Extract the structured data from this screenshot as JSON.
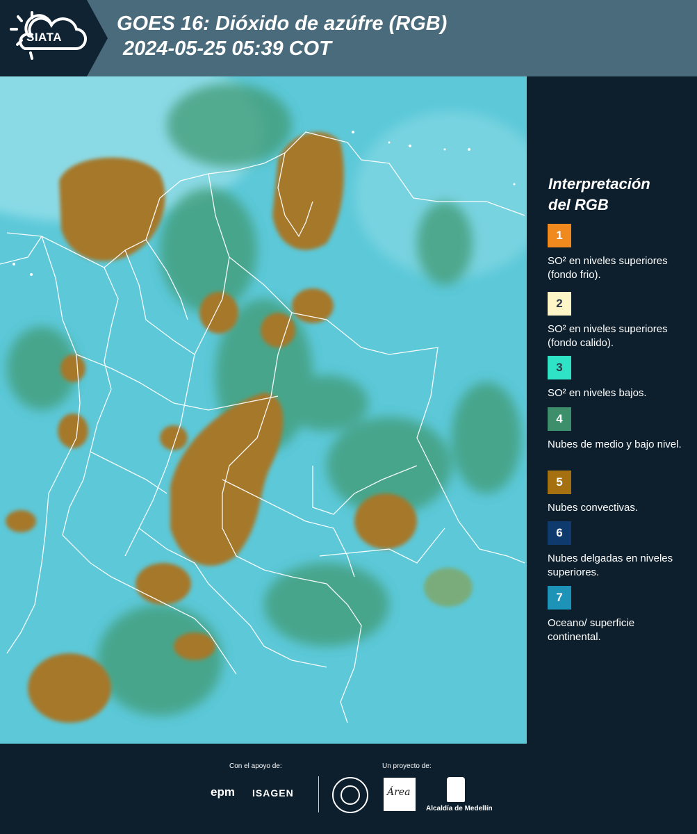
{
  "header": {
    "logo_text": "SIATA",
    "title_line1": "GOES 16: Dióxido de azúfre (RGB)",
    "title_line2": "2024-05-25 05:39 COT",
    "band_color": "#4a6b7c"
  },
  "map": {
    "colors": {
      "ocean_low_so2": "#5ec9d9",
      "mid_low_clouds": "#3f8f6e",
      "convective": "#a5782a",
      "borders": "#ffffff"
    }
  },
  "legend": {
    "title_line1": "Interpretación",
    "title_line2": "del RGB",
    "items": [
      {
        "number": "1",
        "label": "SO² en niveles superiores (fondo frio).",
        "color": "#f08a1e",
        "text_color": "#ffffff"
      },
      {
        "number": "2",
        "label": "SO² en niveles superiores (fondo calido).",
        "color": "#fff6c8",
        "text_color": "#2b3a46"
      },
      {
        "number": "3",
        "label": "SO² en niveles bajos.",
        "color": "#2fe3c7",
        "text_color": "#2b3a46"
      },
      {
        "number": "4",
        "label": "Nubes de medio y bajo nivel.",
        "color": "#3c8f6a",
        "text_color": "#ffffff"
      },
      {
        "number": "5",
        "label": "Nubes convectivas.",
        "color": "#a5700f",
        "text_color": "#ffffff"
      },
      {
        "number": "6",
        "label": "Nubes delgadas en niveles superiores.",
        "color": "#0f3a6e",
        "text_color": "#ffffff"
      },
      {
        "number": "7",
        "label": "Oceano/ superficie continental.",
        "color": "#1d93b8",
        "text_color": "#ffffff"
      }
    ]
  },
  "footer": {
    "support_label": "Con el apoyo de:",
    "project_label": "Un proyecto de:",
    "epm_logo": "epm",
    "isagen_logo": "ISAGEN",
    "area_logo": "Área",
    "alcaldia": "Alcaldía de Medellín"
  }
}
